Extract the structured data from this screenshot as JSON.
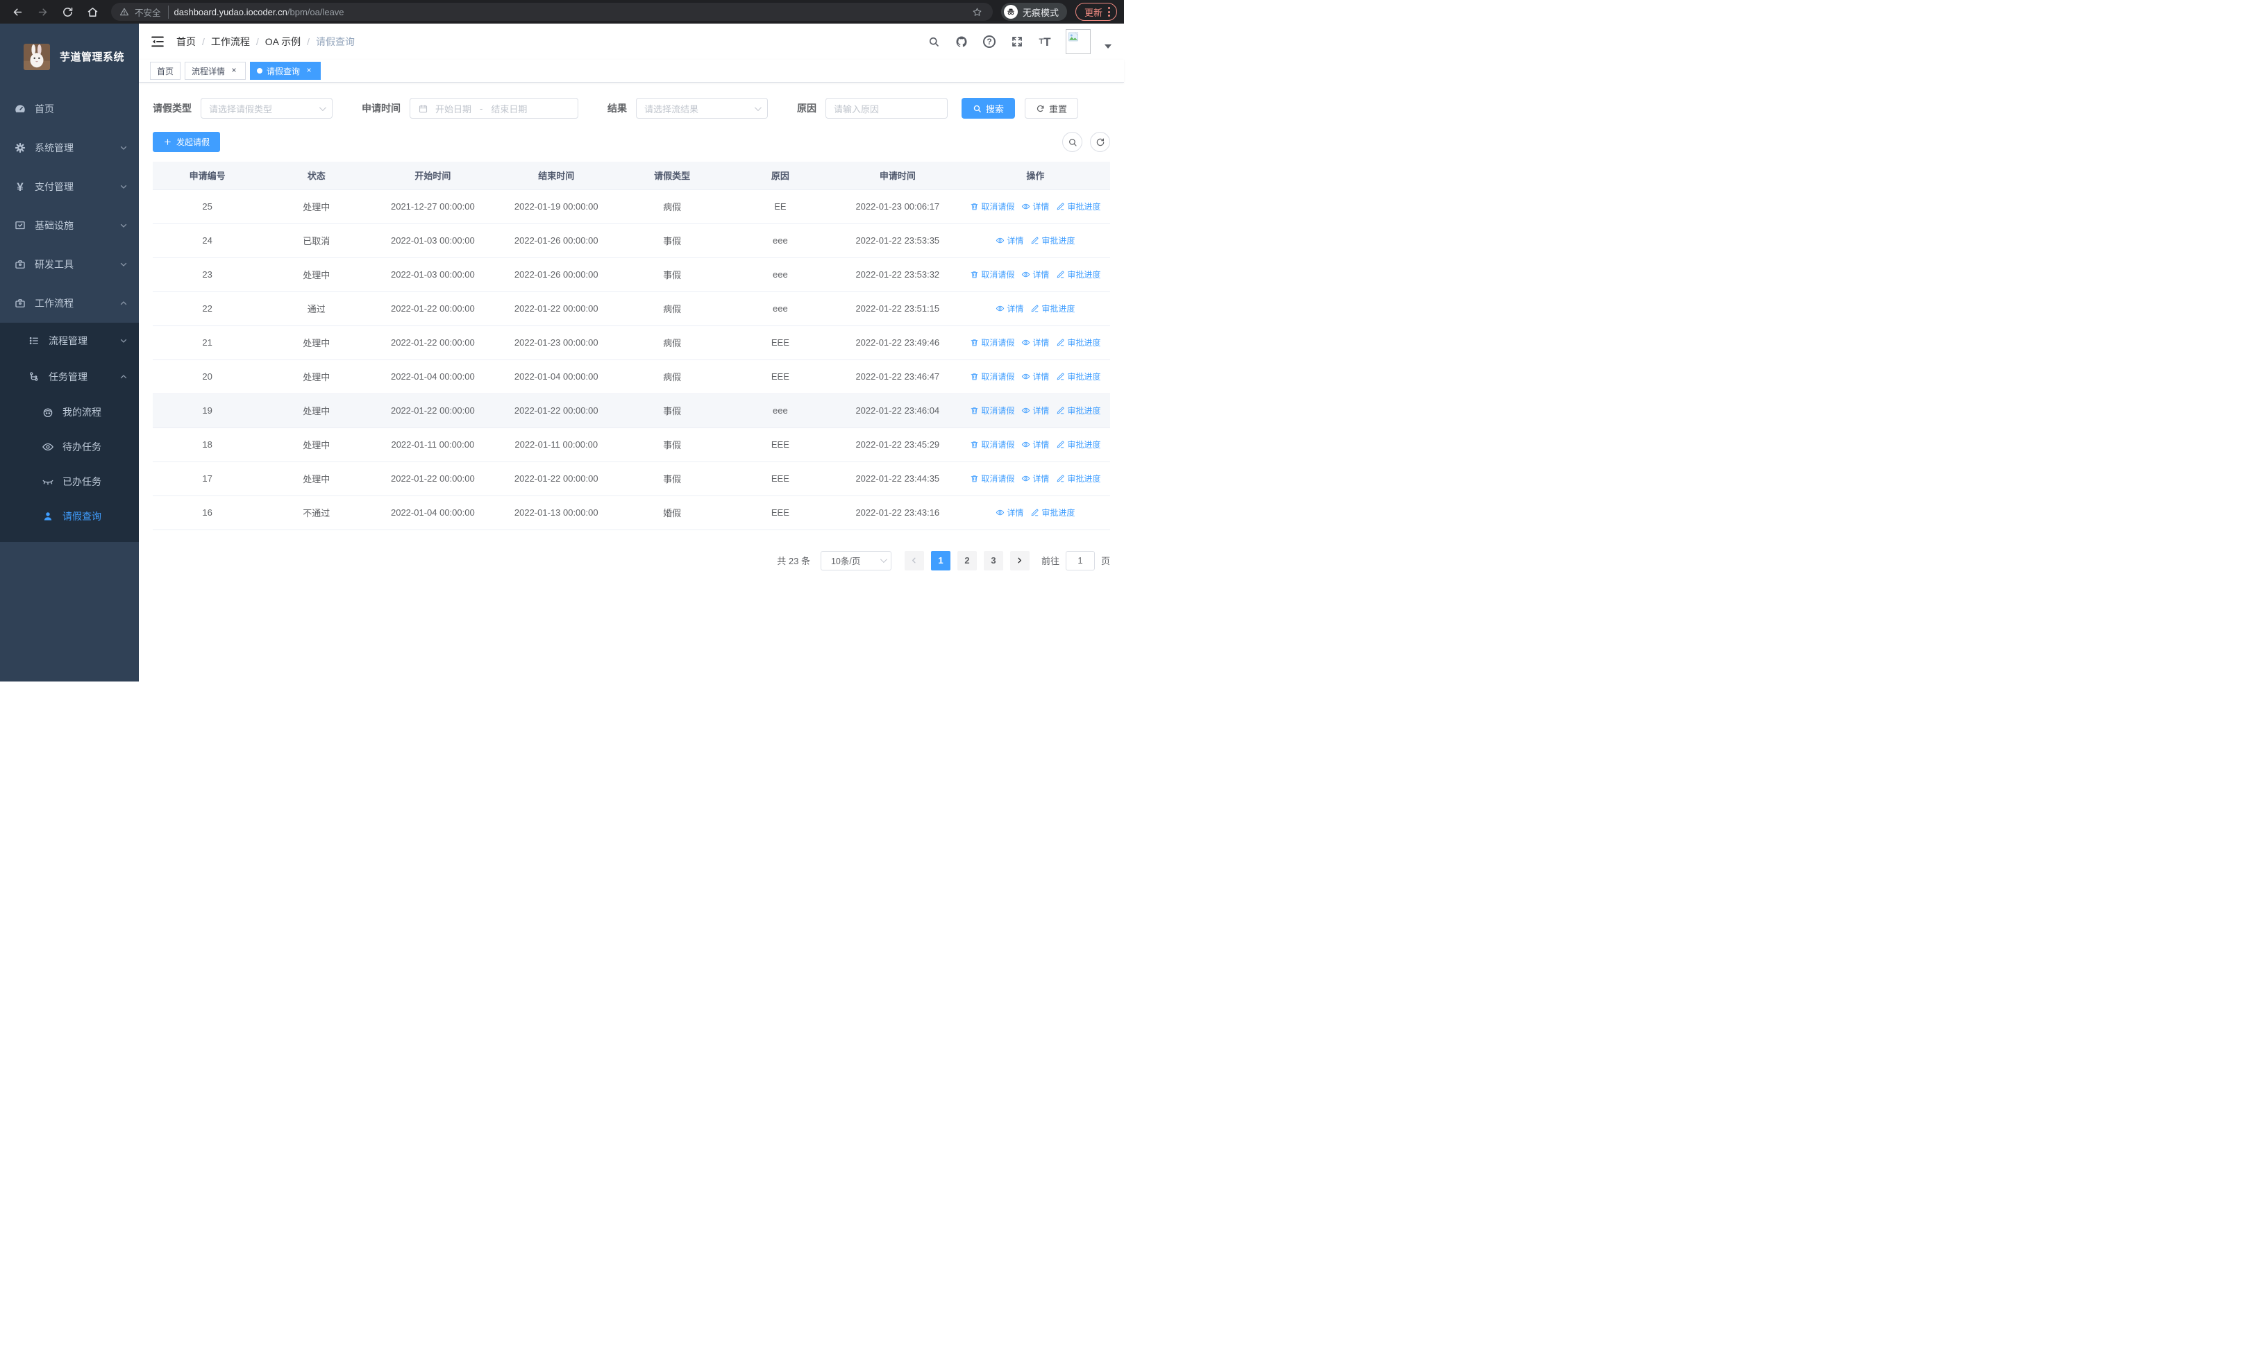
{
  "theme": {
    "accent": "#409eff",
    "sidebar_bg": "#304156",
    "submenu_bg": "#1f2d3d",
    "link_blue": "#409eff",
    "update_red": "#f28b82",
    "table_header_bg": "#f5f7fa"
  },
  "browser": {
    "security_label": "不安全",
    "url_host": "dashboard.yudao.iocoder.cn",
    "url_path": "/bpm/oa/leave",
    "incognito_label": "无痕模式",
    "update_label": "更新"
  },
  "sidebar": {
    "title": "芋道管理系统",
    "items": [
      {
        "label": "首页",
        "icon": "dashboard"
      },
      {
        "label": "系统管理",
        "icon": "gear"
      },
      {
        "label": "支付管理",
        "icon": "yen"
      },
      {
        "label": "基础设施",
        "icon": "monitor-check"
      },
      {
        "label": "研发工具",
        "icon": "briefcase"
      },
      {
        "label": "工作流程",
        "icon": "briefcase",
        "expanded": true
      }
    ],
    "submenu": [
      {
        "label": "流程管理",
        "icon": "list"
      },
      {
        "label": "任务管理",
        "icon": "tree",
        "expanded": true
      }
    ],
    "tasks": [
      {
        "label": "我的流程",
        "icon": "robot"
      },
      {
        "label": "待办任务",
        "icon": "eye"
      },
      {
        "label": "已办任务",
        "icon": "eye-closed"
      },
      {
        "label": "请假查询",
        "icon": "user",
        "active": true
      }
    ]
  },
  "header": {
    "breadcrumb": [
      "首页",
      "工作流程",
      "OA 示例",
      "请假查询"
    ],
    "separator": "/"
  },
  "tabs": {
    "close_glyph": "×",
    "items": [
      {
        "label": "首页",
        "closable": false,
        "active": false
      },
      {
        "label": "流程详情",
        "closable": true,
        "active": false
      },
      {
        "label": "请假查询",
        "closable": true,
        "active": true
      }
    ]
  },
  "filters": {
    "leave_type": {
      "label": "请假类型",
      "placeholder": "请选择请假类型"
    },
    "apply_time": {
      "label": "申请时间",
      "start_placeholder": "开始日期",
      "separator": "-",
      "end_placeholder": "结束日期"
    },
    "result": {
      "label": "结果",
      "placeholder": "请选择流结果"
    },
    "reason": {
      "label": "原因",
      "placeholder": "请输入原因"
    },
    "search_label": "搜索",
    "reset_label": "重置"
  },
  "toolbar": {
    "create_label": "发起请假"
  },
  "table": {
    "columns": [
      "申请编号",
      "状态",
      "开始时间",
      "结束时间",
      "请假类型",
      "原因",
      "申请时间",
      "操作"
    ],
    "action_labels": {
      "cancel": "取消请假",
      "detail": "详情",
      "progress": "审批进度"
    },
    "rows": [
      {
        "id": "25",
        "status": "处理中",
        "start": "2021-12-27 00:00:00",
        "end": "2022-01-19 00:00:00",
        "type": "病假",
        "reason": "EE",
        "apply_time": "2022-01-23 00:06:17",
        "actions": [
          "cancel",
          "detail",
          "progress"
        ],
        "highlight": false
      },
      {
        "id": "24",
        "status": "已取消",
        "start": "2022-01-03 00:00:00",
        "end": "2022-01-26 00:00:00",
        "type": "事假",
        "reason": "eee",
        "apply_time": "2022-01-22 23:53:35",
        "actions": [
          "detail",
          "progress"
        ],
        "highlight": false
      },
      {
        "id": "23",
        "status": "处理中",
        "start": "2022-01-03 00:00:00",
        "end": "2022-01-26 00:00:00",
        "type": "事假",
        "reason": "eee",
        "apply_time": "2022-01-22 23:53:32",
        "actions": [
          "cancel",
          "detail",
          "progress"
        ],
        "highlight": false
      },
      {
        "id": "22",
        "status": "通过",
        "start": "2022-01-22 00:00:00",
        "end": "2022-01-22 00:00:00",
        "type": "病假",
        "reason": "eee",
        "apply_time": "2022-01-22 23:51:15",
        "actions": [
          "detail",
          "progress"
        ],
        "highlight": false
      },
      {
        "id": "21",
        "status": "处理中",
        "start": "2022-01-22 00:00:00",
        "end": "2022-01-23 00:00:00",
        "type": "病假",
        "reason": "EEE",
        "apply_time": "2022-01-22 23:49:46",
        "actions": [
          "cancel",
          "detail",
          "progress"
        ],
        "highlight": false
      },
      {
        "id": "20",
        "status": "处理中",
        "start": "2022-01-04 00:00:00",
        "end": "2022-01-04 00:00:00",
        "type": "病假",
        "reason": "EEE",
        "apply_time": "2022-01-22 23:46:47",
        "actions": [
          "cancel",
          "detail",
          "progress"
        ],
        "highlight": false
      },
      {
        "id": "19",
        "status": "处理中",
        "start": "2022-01-22 00:00:00",
        "end": "2022-01-22 00:00:00",
        "type": "事假",
        "reason": "eee",
        "apply_time": "2022-01-22 23:46:04",
        "actions": [
          "cancel",
          "detail",
          "progress"
        ],
        "highlight": true
      },
      {
        "id": "18",
        "status": "处理中",
        "start": "2022-01-11 00:00:00",
        "end": "2022-01-11 00:00:00",
        "type": "事假",
        "reason": "EEE",
        "apply_time": "2022-01-22 23:45:29",
        "actions": [
          "cancel",
          "detail",
          "progress"
        ],
        "highlight": false
      },
      {
        "id": "17",
        "status": "处理中",
        "start": "2022-01-22 00:00:00",
        "end": "2022-01-22 00:00:00",
        "type": "事假",
        "reason": "EEE",
        "apply_time": "2022-01-22 23:44:35",
        "actions": [
          "cancel",
          "detail",
          "progress"
        ],
        "highlight": false
      },
      {
        "id": "16",
        "status": "不通过",
        "start": "2022-01-04 00:00:00",
        "end": "2022-01-13 00:00:00",
        "type": "婚假",
        "reason": "EEE",
        "apply_time": "2022-01-22 23:43:16",
        "actions": [
          "detail",
          "progress"
        ],
        "highlight": false
      }
    ]
  },
  "pagination": {
    "total_label": "共 23 条",
    "page_size": "10条/页",
    "pages": [
      "1",
      "2",
      "3"
    ],
    "active_page": "1",
    "goto_label": "前往",
    "goto_value": "1",
    "page_suffix": "页"
  }
}
